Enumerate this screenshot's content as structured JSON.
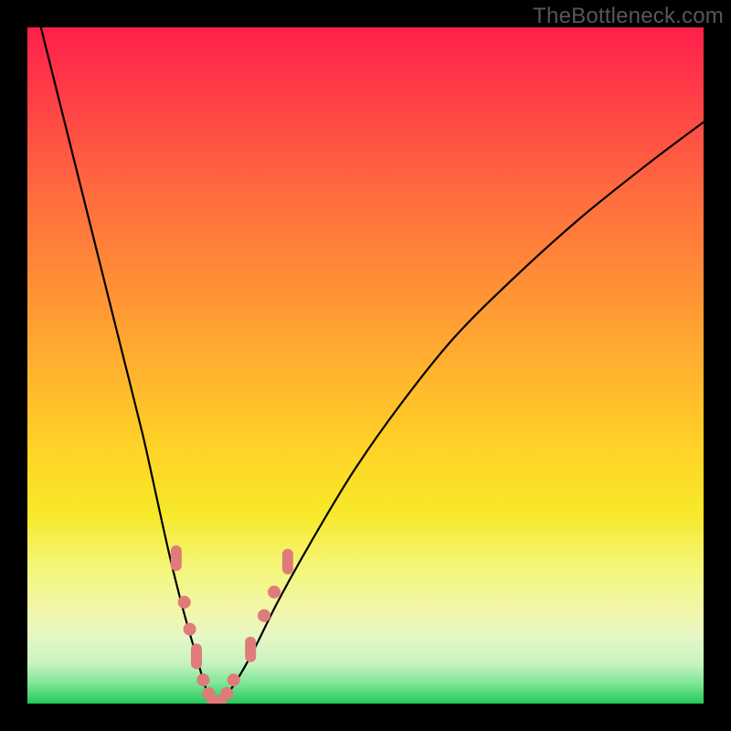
{
  "watermark": "TheBottleneck.com",
  "chart_data": {
    "type": "line",
    "title": "",
    "xlabel": "",
    "ylabel": "",
    "xlim": [
      0,
      100
    ],
    "ylim": [
      0,
      100
    ],
    "series": [
      {
        "name": "bottleneck-curve",
        "x": [
          2,
          5,
          8,
          11,
          14,
          17,
          19,
          21,
          23,
          25,
          26.5,
          28,
          30,
          33,
          37,
          42,
          48,
          55,
          63,
          72,
          82,
          92,
          100
        ],
        "y": [
          100,
          88,
          76,
          64,
          52,
          40,
          31,
          22,
          14,
          7,
          2,
          0,
          2,
          7,
          15,
          24,
          34,
          44,
          54,
          63,
          72,
          80,
          86
        ]
      }
    ],
    "markers": {
      "name": "highlighted-points",
      "color": "#e07b7b",
      "points": [
        {
          "x": 22.0,
          "y": 21.5,
          "shape": "capsule-v"
        },
        {
          "x": 23.2,
          "y": 15.0,
          "shape": "circle"
        },
        {
          "x": 24.0,
          "y": 11.0,
          "shape": "circle"
        },
        {
          "x": 25.0,
          "y": 7.0,
          "shape": "capsule-v"
        },
        {
          "x": 26.0,
          "y": 3.5,
          "shape": "circle"
        },
        {
          "x": 26.8,
          "y": 1.5,
          "shape": "circle"
        },
        {
          "x": 27.5,
          "y": 0.3,
          "shape": "circle"
        },
        {
          "x": 28.5,
          "y": 0.3,
          "shape": "circle"
        },
        {
          "x": 29.5,
          "y": 1.5,
          "shape": "circle"
        },
        {
          "x": 30.5,
          "y": 3.5,
          "shape": "circle"
        },
        {
          "x": 33.0,
          "y": 8.0,
          "shape": "capsule-v"
        },
        {
          "x": 35.0,
          "y": 13.0,
          "shape": "circle"
        },
        {
          "x": 36.5,
          "y": 16.5,
          "shape": "circle"
        },
        {
          "x": 38.5,
          "y": 21.0,
          "shape": "capsule-v"
        }
      ]
    },
    "background_gradient": {
      "top": "#ff1f4a",
      "mid": "#ffd227",
      "bottom": "#23c95a"
    }
  }
}
